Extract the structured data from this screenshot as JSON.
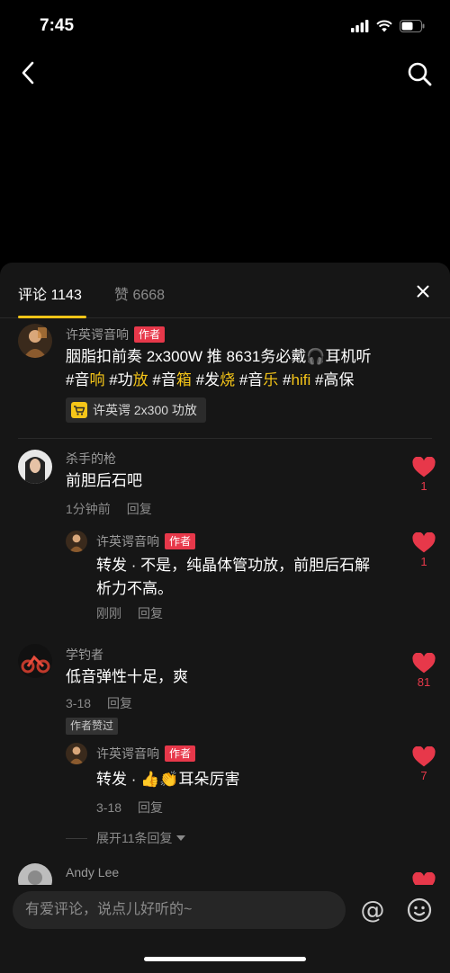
{
  "status": {
    "time": "7:45"
  },
  "panel": {
    "tab_comments": "评论 1143",
    "tab_likes": "赞 6668"
  },
  "comments": {
    "c1": {
      "name": "许英谔音响",
      "author_tag": "作者",
      "text_line1": "胭脂扣前奏 2x300W 推 8631务必戴🎧耳机听",
      "tags": [
        {
          "a": "#音",
          "b": "响"
        },
        {
          "a": "#功",
          "b": "放"
        },
        {
          "a": "#音",
          "b": "箱"
        },
        {
          "a": "#发",
          "b": "烧"
        },
        {
          "a": "#音",
          "b": "乐"
        },
        {
          "a": "#",
          "b": "hifi"
        },
        {
          "a": "#高保",
          "b": ""
        }
      ],
      "product": "许英谔 2x300 功放"
    },
    "c2": {
      "name": "杀手的枪",
      "text": "前胆后石吧",
      "time": "1分钟前",
      "reply": "回复",
      "likes": "1",
      "sub": {
        "name": "许英谔音响",
        "author_tag": "作者",
        "text_line1": "转发 · 不是，纯晶体管功放，前胆后石解",
        "text_line2": "析力不高。",
        "time": "刚刚",
        "reply": "回复",
        "likes": "1"
      }
    },
    "c3": {
      "name": "学钓者",
      "text": "低音弹性十足，爽",
      "time": "3-18",
      "reply": "回复",
      "likes": "81",
      "badge": "作者赞过",
      "sub": {
        "name": "许英谔音响",
        "author_tag": "作者",
        "text": "转发 · 👍👏耳朵厉害",
        "time": "3-18",
        "reply": "回复",
        "likes": "7"
      },
      "expand": "展开11条回复"
    },
    "c4": {
      "name": "Andy Lee"
    }
  },
  "input": {
    "placeholder": "有爱评论，说点儿好听的~"
  },
  "colors": {
    "accent": "#f5c518",
    "like": "#e7384a",
    "author_tag": "#e7384a"
  }
}
